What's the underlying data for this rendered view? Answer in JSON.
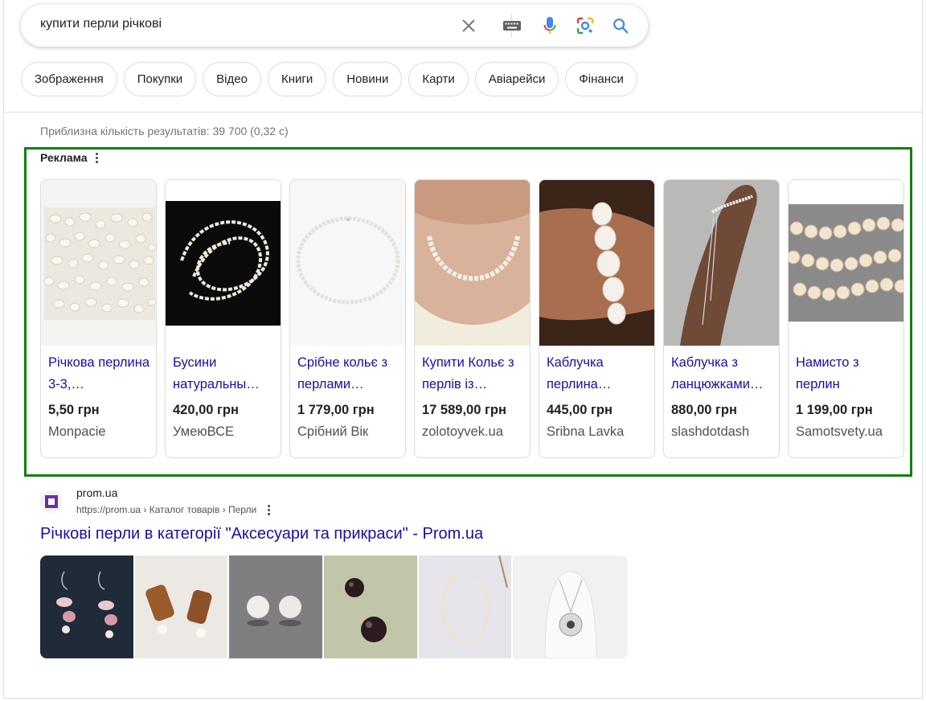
{
  "search": {
    "query": "купити перли річкові",
    "icons": [
      "close-icon",
      "keyboard-icon",
      "microphone-icon",
      "lens-icon",
      "search-icon"
    ]
  },
  "chips": [
    "Зображення",
    "Покупки",
    "Відео",
    "Книги",
    "Новини",
    "Карти",
    "Авіарейси",
    "Фінанси"
  ],
  "stats": "Приблизна кількість результатів: 39 700 (0,32 с)",
  "ads": {
    "label": "Реклама",
    "border_color": "#118011",
    "products": [
      {
        "title": "Річкова перлина 3-3,…",
        "price": "5,50 грн",
        "shop": "Monpacie"
      },
      {
        "title": "Бусини натуральны…",
        "price": "420,00 грн",
        "shop": "УмеюВСЕ"
      },
      {
        "title": "Срібне кольє з перлами…",
        "price": "1 779,00 грн",
        "shop": "Срібний Вік"
      },
      {
        "title": "Купити Кольє з перлів із…",
        "price": "17 589,00 грн",
        "shop": "zolotoyvek.ua"
      },
      {
        "title": "Каблучка перлина…",
        "price": "445,00 грн",
        "shop": "Sribna Lavka"
      },
      {
        "title": "Каблучка з ланцюжками…",
        "price": "880,00 грн",
        "shop": "slashdotdash"
      },
      {
        "title": "Намисто з перлин",
        "price": "1 199,00 грн",
        "shop": "Samotsvety.ua"
      }
    ]
  },
  "result": {
    "site_name": "prom.ua",
    "breadcrumb": "https://prom.ua › Каталог товарів › Перли",
    "title": "Річкові перли в категорії \"Аксесуари та прикраси\" - Prom.ua",
    "link_color": "#1a0dab"
  }
}
